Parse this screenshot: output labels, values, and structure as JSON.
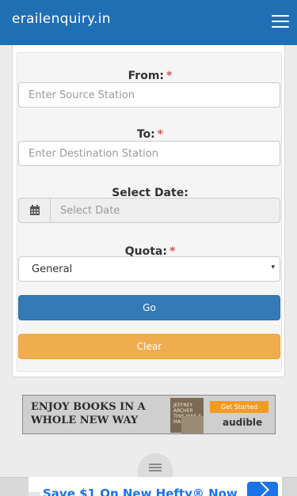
{
  "navbar": {
    "brand": "erailenquiry.in",
    "menu_icon": "hamburger-icon"
  },
  "form": {
    "from": {
      "label": "From:",
      "required_mark": "*",
      "placeholder": "Enter Source Station",
      "value": ""
    },
    "to": {
      "label": "To:",
      "required_mark": "*",
      "placeholder": "Enter Destination Station",
      "value": ""
    },
    "date": {
      "label": "Select Date:",
      "placeholder": "Select Date",
      "icon": "calendar-icon",
      "value": ""
    },
    "quota": {
      "label": "Quota:",
      "required_mark": "*",
      "selected": "General",
      "arrow": "▾"
    },
    "go_label": "Go",
    "clear_label": "Clear"
  },
  "ad_banner": {
    "text": "ENJOY BOOKS IN A WHOLE NEW WAY",
    "book_text": "JEFFREY ARCHER THIS WAS A MAN",
    "cta": "Get Started",
    "logo": "audible"
  },
  "bottom_ad": {
    "text": "Save $1 On New Hefty® Now",
    "button_icon": "chevron-right-icon"
  },
  "colors": {
    "navbar": "#1f6fb5",
    "go_button": "#337ab7",
    "clear_button": "#f0ad4e",
    "required": "#d9534f"
  }
}
